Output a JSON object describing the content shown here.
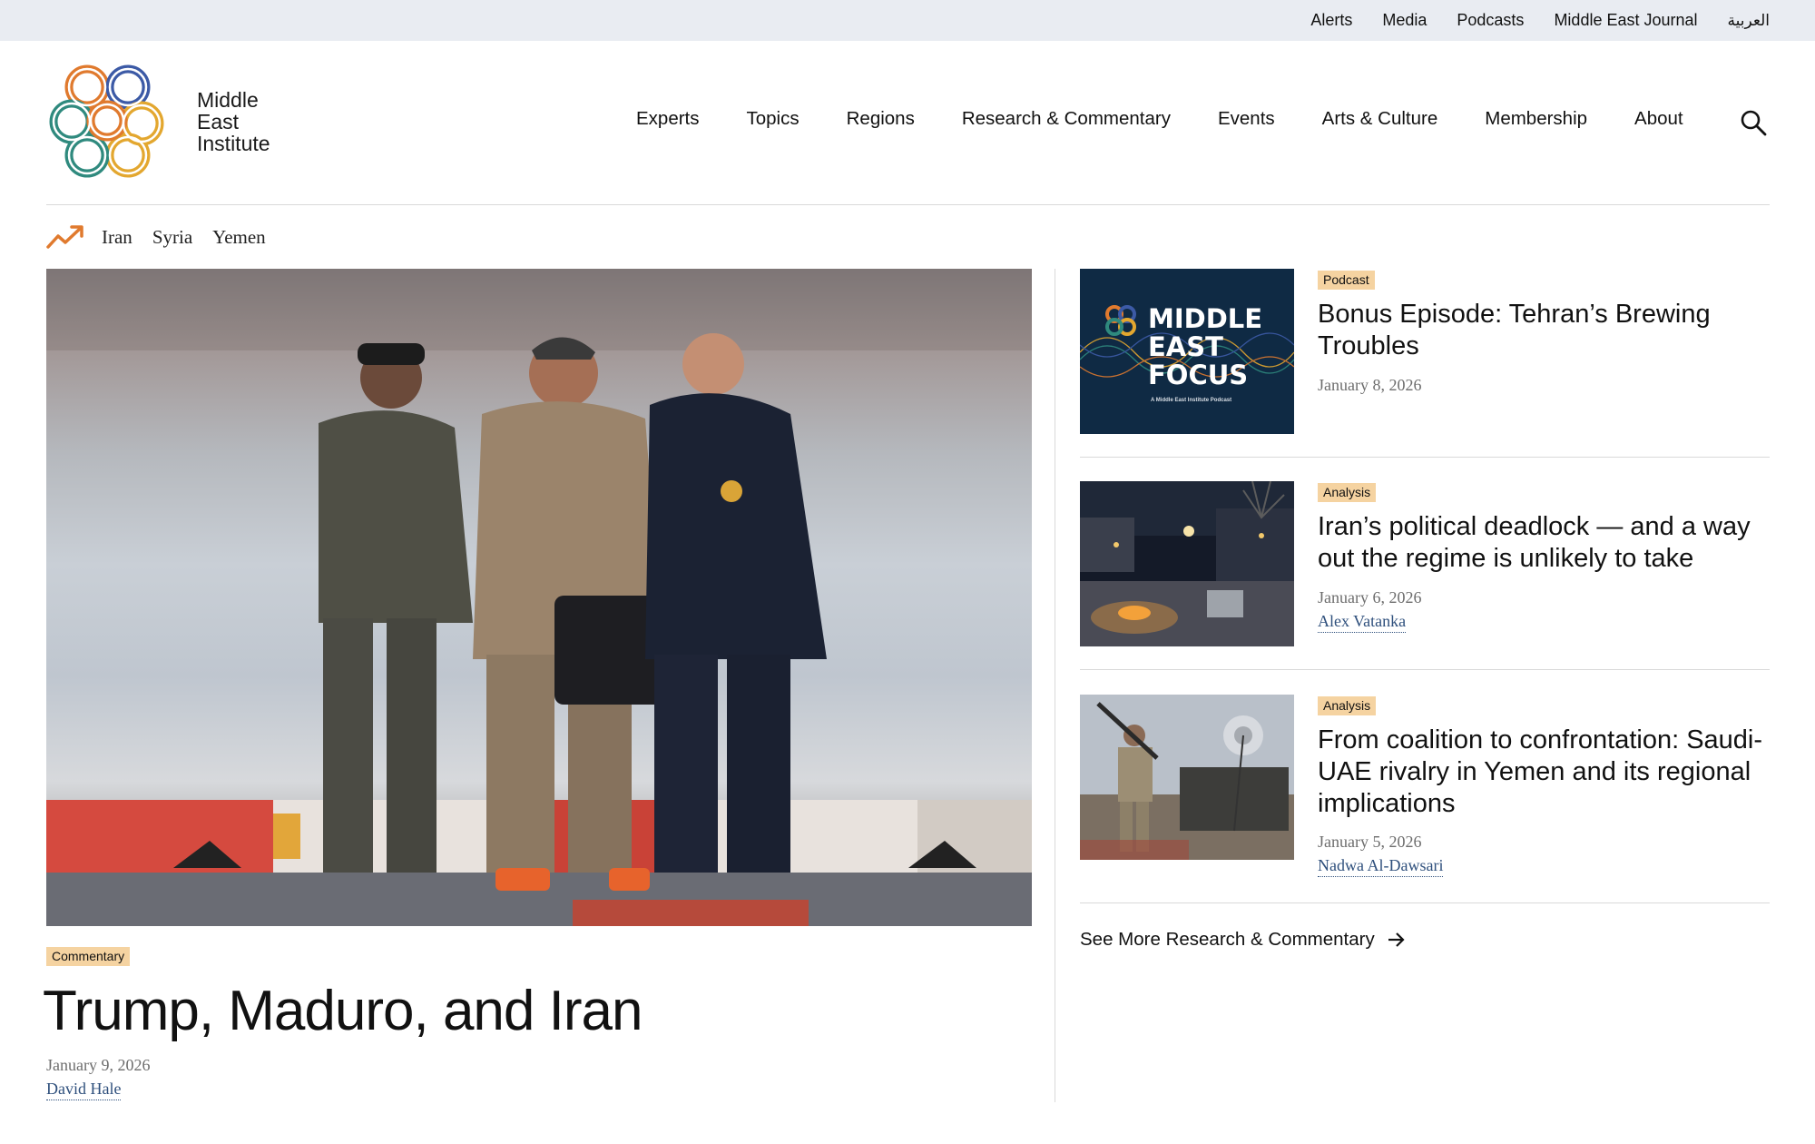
{
  "utility_nav": [
    "Alerts",
    "Media",
    "Podcasts",
    "Middle East Journal",
    "العربية"
  ],
  "brand": {
    "line1": "Middle",
    "line2": "East",
    "line3": "Institute"
  },
  "main_nav": [
    "Experts",
    "Topics",
    "Regions",
    "Research & Commentary",
    "Events",
    "Arts & Culture",
    "Membership",
    "About"
  ],
  "icons": {
    "search": "search-icon",
    "trending": "trending-up-icon",
    "arrow": "arrow-right-icon"
  },
  "trending": [
    "Iran",
    "Syria",
    "Yemen"
  ],
  "lead": {
    "tag": "Commentary",
    "title": "Trump, Maduro, and Iran",
    "date": "January 9, 2026",
    "author": "David Hale"
  },
  "cards": [
    {
      "tag": "Podcast",
      "title": "Bonus Episode: Tehran’s Brewing Troubles",
      "date": "January 8, 2026",
      "author": "",
      "thumb_line1": "MIDDLE",
      "thumb_line2": "EAST",
      "thumb_line3": "FOCUS",
      "thumb_sub": "A Middle East Institute Podcast"
    },
    {
      "tag": "Analysis",
      "title": "Iran’s political deadlock — and a way out the regime is unlikely to take",
      "date": "January 6, 2026",
      "author": "Alex Vatanka"
    },
    {
      "tag": "Analysis",
      "title": "From coalition to confrontation: Saudi-UAE rivalry in Yemen and its regional implications",
      "date": "January 5, 2026",
      "author": "Nadwa Al-Dawsari"
    }
  ],
  "see_more": "See More Research & Commentary",
  "colors": {
    "tag_bg": "#f5d3a1",
    "link": "#2e4f7c",
    "utility_bg": "#e9ecf2",
    "accent_orange": "#e07a2e"
  }
}
